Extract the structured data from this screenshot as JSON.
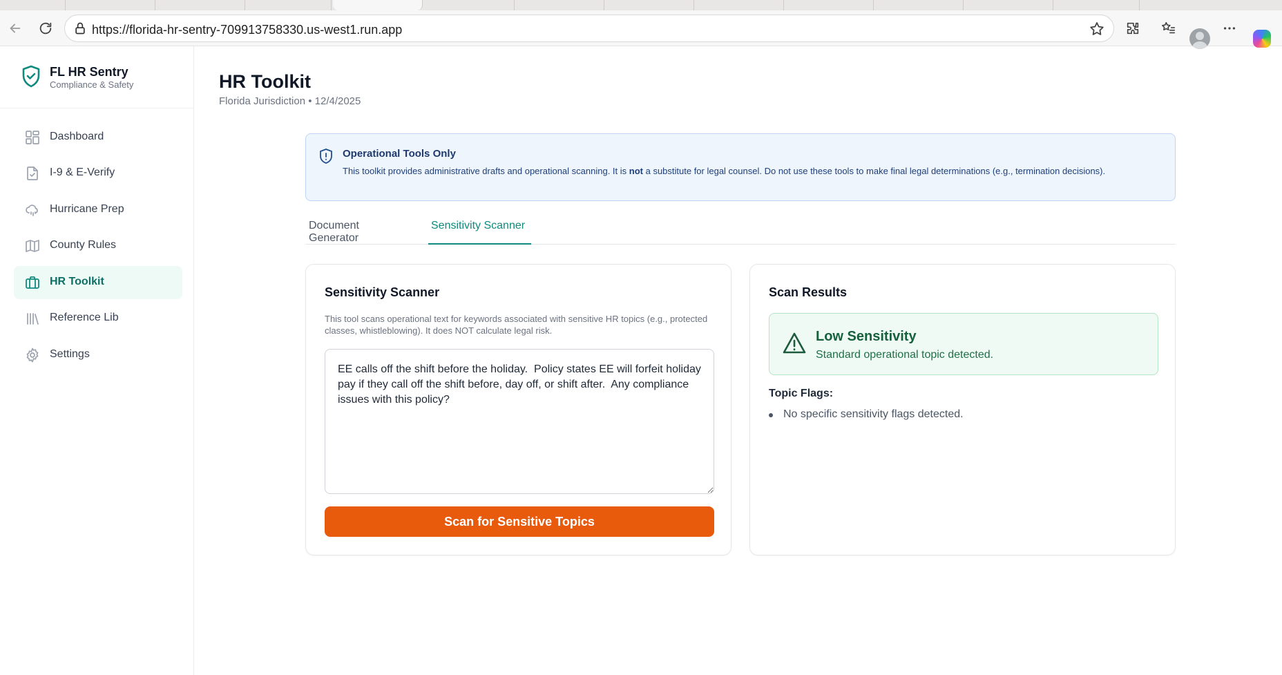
{
  "browser": {
    "url": "https://florida-hr-sentry-709913758330.us-west1.run.app"
  },
  "app": {
    "name": "FL HR Sentry",
    "tagline": "Compliance & Safety"
  },
  "sidebar": {
    "items": [
      {
        "label": "Dashboard",
        "icon": "dashboard-icon"
      },
      {
        "label": "I-9 & E-Verify",
        "icon": "document-check-icon"
      },
      {
        "label": "Hurricane Prep",
        "icon": "storm-cloud-icon"
      },
      {
        "label": "County Rules",
        "icon": "map-icon"
      },
      {
        "label": "HR Toolkit",
        "icon": "briefcase-icon",
        "active": true
      },
      {
        "label": "Reference Lib",
        "icon": "library-icon"
      },
      {
        "label": "Settings",
        "icon": "gear-icon"
      }
    ]
  },
  "page": {
    "title": "HR Toolkit",
    "subtitle": "Florida Jurisdiction • 12/4/2025"
  },
  "notice": {
    "title": "Operational Tools Only",
    "text_before": "This toolkit provides administrative drafts and operational scanning. It is ",
    "text_bold": "not",
    "text_after": " a substitute for legal counsel. Do not use these tools to make final legal determinations (e.g., termination decisions)."
  },
  "tabs": [
    {
      "label": "Document Generator",
      "active": false
    },
    {
      "label": "Sensitivity Scanner",
      "active": true
    }
  ],
  "scanner": {
    "title": "Sensitivity Scanner",
    "description": "This tool scans operational text for keywords associated with sensitive HR topics (e.g., protected classes, whistleblowing). It does NOT calculate legal risk.",
    "input_value": "EE calls off the shift before the holiday.  Policy states EE will forfeit holiday pay if they call off the shift before, day off, or shift after.  Any compliance issues with this policy?",
    "button_label": "Scan for Sensitive Topics"
  },
  "results": {
    "title": "Scan Results",
    "level": "Low Sensitivity",
    "detail": "Standard operational topic detected.",
    "flags_heading": "Topic Flags:",
    "flags": [
      "No specific sensitivity flags detected."
    ]
  },
  "colors": {
    "brand": "#0f8a7e",
    "primary_button": "#e85a0c",
    "success_bg": "#eefaf3",
    "info_bg": "#eef5fd"
  }
}
